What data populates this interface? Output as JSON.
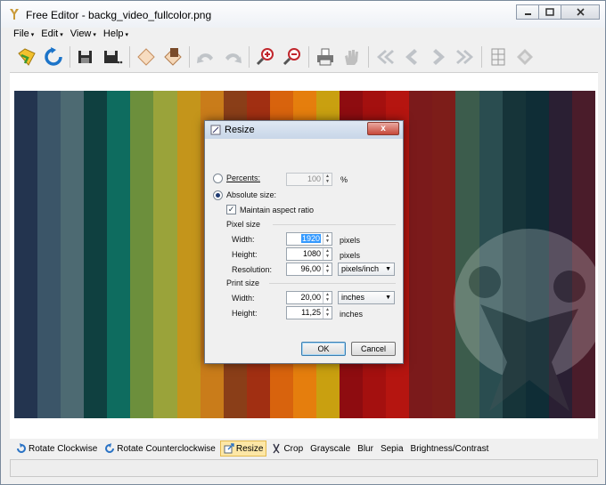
{
  "window": {
    "title": "Free Editor - backg_video_fullcolor.png"
  },
  "menu": [
    {
      "label": "File",
      "caret": "▾"
    },
    {
      "label": "Edit",
      "caret": "▾"
    },
    {
      "label": "View",
      "caret": "▾"
    },
    {
      "label": "Help",
      "caret": "▾"
    }
  ],
  "toolbar_icons": [
    "open-icon",
    "reload-icon",
    "save-icon",
    "save-as-icon",
    "eraser-icon",
    "paste-icon",
    "undo-icon",
    "redo-icon",
    "zoom-in-icon",
    "zoom-out-icon",
    "print-icon",
    "hand-icon",
    "first-icon",
    "previous-icon",
    "next-icon",
    "last-icon",
    "grid-icon",
    "fit-icon"
  ],
  "image": {
    "stripes": [
      "#23344f",
      "#3b5568",
      "#4d6a72",
      "#0f4040",
      "#0e6c5f",
      "#6c8f3c",
      "#9aa33a",
      "#c4951b",
      "#c97c1a",
      "#8a3e18",
      "#a12f12",
      "#d8630d",
      "#e57e0d",
      "#c9a010",
      "#8e0c10",
      "#a4100f",
      "#b51510",
      "#7b1a1b",
      "#7d1d19",
      "#3c5c4c",
      "#2a4d50",
      "#163439",
      "#0f2d36",
      "#2a1f33",
      "#4a1c2a"
    ]
  },
  "dialog": {
    "title": "Resize",
    "close": "x",
    "percents_label": "Percents:",
    "percents_value": "100",
    "percent_unit": "%",
    "absolute_label": "Absolute size:",
    "maintain_label": "Maintain aspect ratio",
    "check_mark": "✓",
    "pixel_size_label": "Pixel size",
    "width_label": "Width:",
    "width_value": "1920",
    "width_unit": "pixels",
    "height_label": "Height:",
    "height_value": "1080",
    "height_unit": "pixels",
    "resolution_label": "Resolution:",
    "resolution_value": "96,00",
    "resolution_unit": "pixels/inch",
    "print_size_label": "Print size",
    "print_width_label": "Width:",
    "print_width_value": "20,00",
    "print_width_unit": "inches",
    "print_height_label": "Height:",
    "print_height_value": "11,25",
    "print_height_unit": "inches",
    "ok": "OK",
    "cancel": "Cancel"
  },
  "actions": [
    {
      "label": "Rotate Clockwise",
      "icon": "rotate-cw-icon",
      "active": false
    },
    {
      "label": "Rotate Counterclockwise",
      "icon": "rotate-ccw-icon",
      "active": false
    },
    {
      "label": "Resize",
      "icon": "resize-icon",
      "active": true
    },
    {
      "label": "Crop",
      "icon": "crop-icon",
      "active": false
    },
    {
      "label": "Grayscale",
      "icon": "",
      "active": false
    },
    {
      "label": "Blur",
      "icon": "",
      "active": false
    },
    {
      "label": "Sepia",
      "icon": "",
      "active": false
    },
    {
      "label": "Brightness/Contrast",
      "icon": "",
      "active": false
    }
  ]
}
